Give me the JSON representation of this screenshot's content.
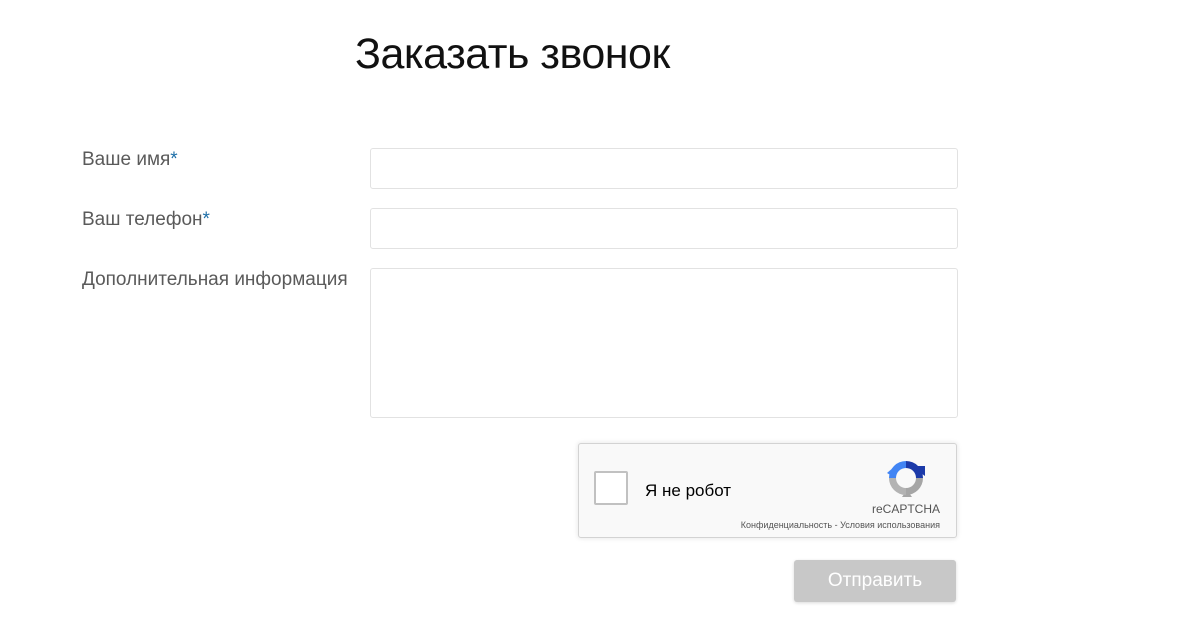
{
  "page": {
    "title": "Заказать звонок"
  },
  "form": {
    "name": {
      "label": "Ваше имя",
      "required_mark": "*",
      "value": "",
      "placeholder": ""
    },
    "phone": {
      "label": "Ваш телефон",
      "required_mark": "*",
      "value": "",
      "placeholder": ""
    },
    "info": {
      "label": "Дополнительная информация",
      "value": "",
      "placeholder": ""
    },
    "submit_label": "Отправить"
  },
  "captcha": {
    "label": "Я не робот",
    "brand": "reCAPTCHA",
    "privacy_link": "Конфиденциальность",
    "separator": " - ",
    "terms_link": "Условия использования",
    "checked": false
  },
  "colors": {
    "required_mark": "#1e6fa8",
    "submit_button_bg": "#c8c8c8",
    "submit_button_text": "#ffffff",
    "input_border": "#e2e2e2"
  }
}
